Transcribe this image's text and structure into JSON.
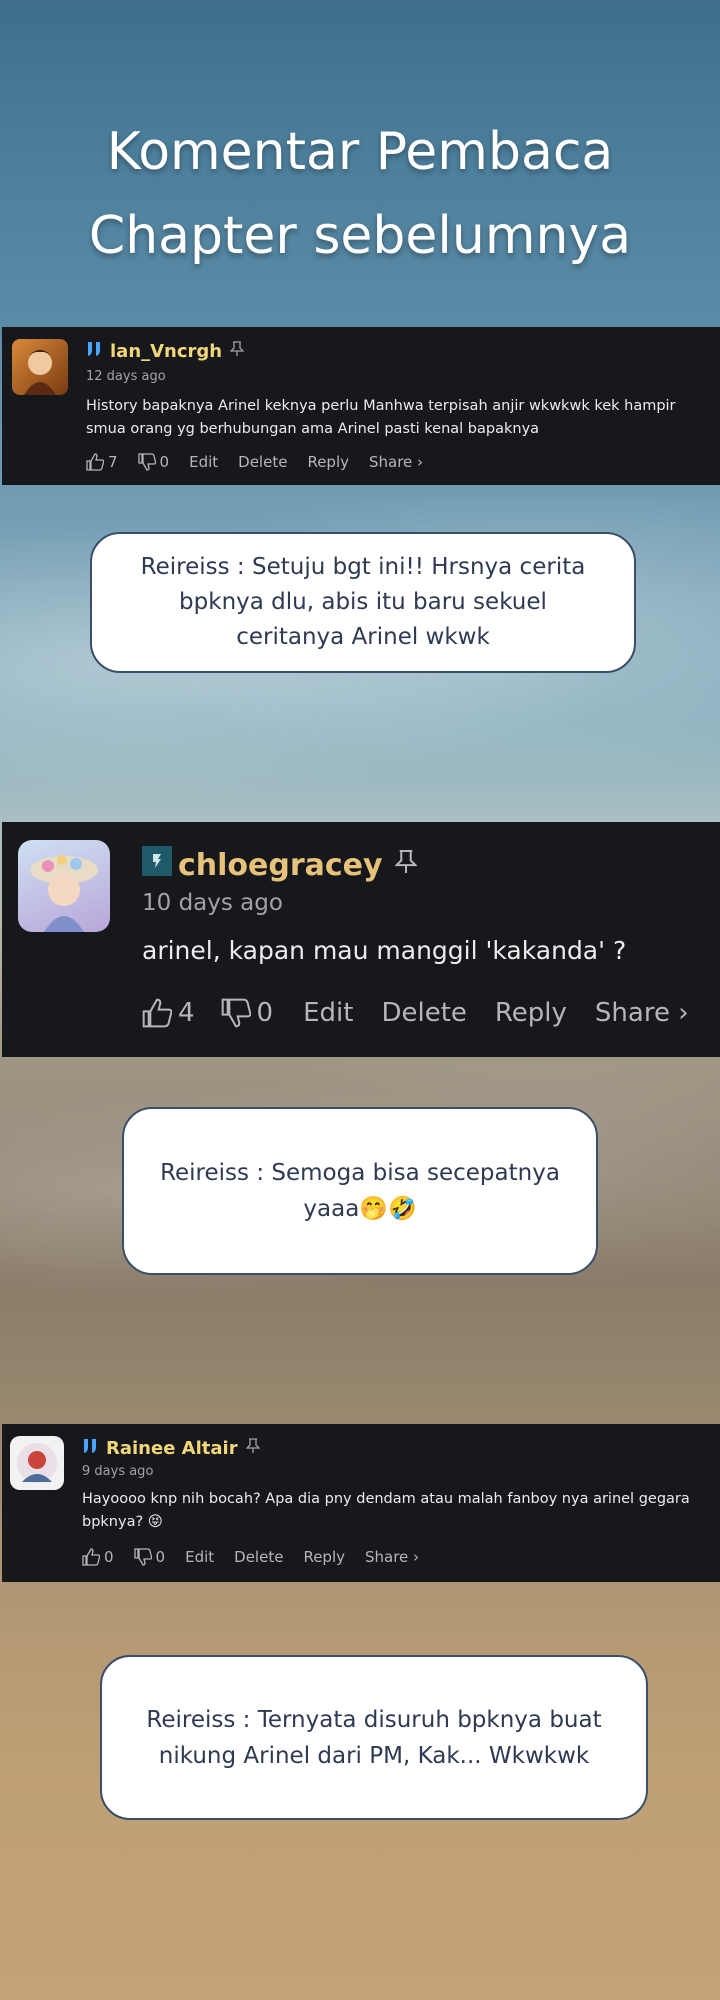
{
  "title": {
    "line1": "Komentar Pembaca",
    "line2": "Chapter sebelumnya"
  },
  "comments": [
    {
      "username": "lan_Vncrgh",
      "time": "12 days ago",
      "text": "History bapaknya Arinel keknya perlu Manhwa terpisah anjir wkwkwk kek hampir smua orang yg berhubungan ama Arinel pasti kenal bapaknya",
      "likes": "7",
      "dislikes": "0",
      "edit": "Edit",
      "delete": "Delete",
      "reply": "Reply",
      "share": "Share ›"
    },
    {
      "username": "chloegracey",
      "time": "10 days ago",
      "text": "arinel, kapan mau manggil 'kakanda' ?",
      "likes": "4",
      "dislikes": "0",
      "edit": "Edit",
      "delete": "Delete",
      "reply": "Reply",
      "share": "Share ›"
    },
    {
      "username": "Rainee Altair",
      "time": "9 days ago",
      "text": "Hayoooo knp nih bocah? Apa dia pny dendam atau malah fanboy nya arinel gegara bpknya? 😝",
      "likes": "0",
      "dislikes": "0",
      "edit": "Edit",
      "delete": "Delete",
      "reply": "Reply",
      "share": "Share ›"
    }
  ],
  "replies": [
    {
      "text": "Reireiss : Setuju bgt ini!! Hrsnya cerita bpknya dlu, abis itu baru sekuel ceritanya Arinel wkwk"
    },
    {
      "text": "Reireiss : Semoga bisa secepatnya yaaa🤭🤣"
    },
    {
      "text": "Reireiss : Ternyata disuruh bpknya buat nikung Arinel dari PM, Kak... Wkwkwk"
    }
  ],
  "colors": {
    "card_bg": "#17181c",
    "username": "#f2d67a",
    "bubble_border": "#3a4e6a"
  }
}
